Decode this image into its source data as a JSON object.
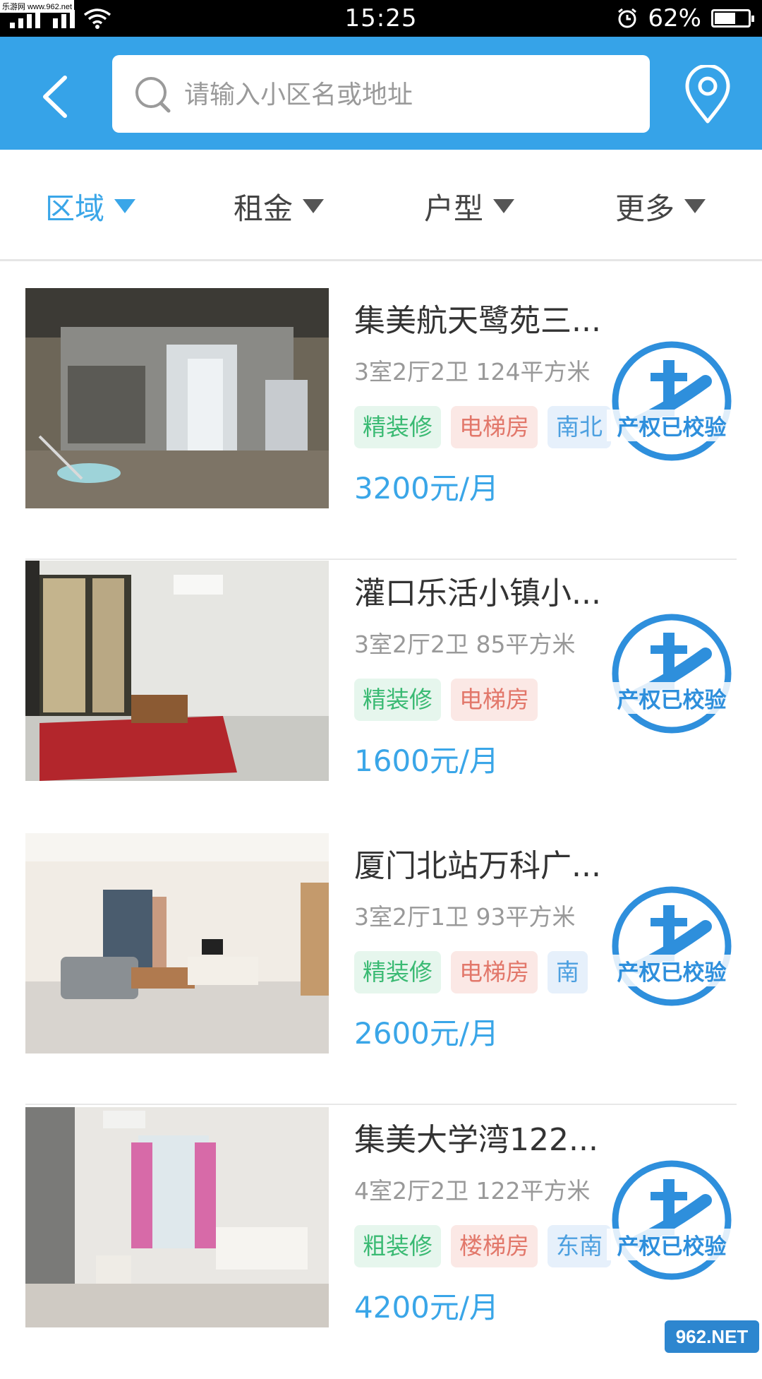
{
  "status_bar": {
    "watermark": "乐游网 www.962.net",
    "time": "15:25",
    "battery": "62%",
    "battery_level": 0.62
  },
  "header": {
    "search_placeholder": "请输入小区名或地址"
  },
  "filters": [
    {
      "label": "区域",
      "active": true
    },
    {
      "label": "租金",
      "active": false
    },
    {
      "label": "户型",
      "active": false
    },
    {
      "label": "更多",
      "active": false
    }
  ],
  "listings": [
    {
      "title": "集美航天鹭苑三...",
      "info": "3室2厅2卫 124平方米",
      "tags": [
        "精装修",
        "电梯房",
        "南北"
      ],
      "price": "3200元/月",
      "badge": "产权已校验"
    },
    {
      "title": "灌口乐活小镇小...",
      "info": "3室2厅2卫 85平方米",
      "tags": [
        "精装修",
        "电梯房"
      ],
      "price": "1600元/月",
      "badge": "产权已校验"
    },
    {
      "title": "厦门北站万科广...",
      "info": "3室2厅1卫 93平方米",
      "tags": [
        "精装修",
        "电梯房",
        "南"
      ],
      "price": "2600元/月",
      "badge": "产权已校验"
    },
    {
      "title": "集美大学湾122...",
      "info": "4室2厅2卫 122平方米",
      "tags": [
        "粗装修",
        "楼梯房",
        "东南"
      ],
      "price": "4200元/月",
      "badge": "产权已校验"
    }
  ],
  "footer": {
    "logo_text": "962.NET"
  },
  "colors": {
    "accent": "#36a3e8",
    "price": "#3aa6e8",
    "tag_green": "#3aba73",
    "tag_red": "#e2776a",
    "tag_blue": "#4da0e0"
  }
}
